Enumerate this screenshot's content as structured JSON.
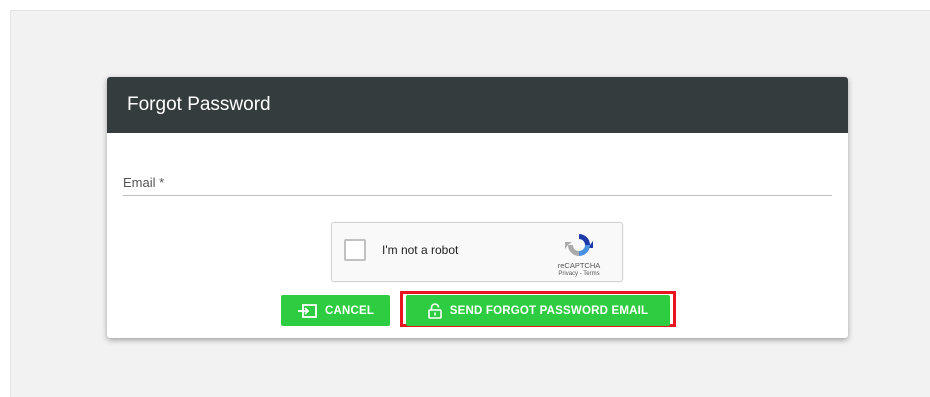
{
  "dialog": {
    "title": "Forgot Password"
  },
  "form": {
    "email_label": "Email *",
    "email_value": ""
  },
  "recaptcha": {
    "checkbox_label": "I'm not a robot",
    "brand": "reCAPTCHA",
    "links": "Privacy - Terms"
  },
  "actions": {
    "cancel_label": "CANCEL",
    "send_label": "SEND FORGOT PASSWORD EMAIL"
  },
  "colors": {
    "header_bg": "#353c3d",
    "button_bg": "#2ecc40",
    "highlight_border": "#e8141f",
    "page_bg": "#f2f2f2"
  },
  "icons": {
    "cancel": "exit-icon",
    "send": "unlock-icon",
    "recaptcha": "recaptcha-logo-icon"
  }
}
